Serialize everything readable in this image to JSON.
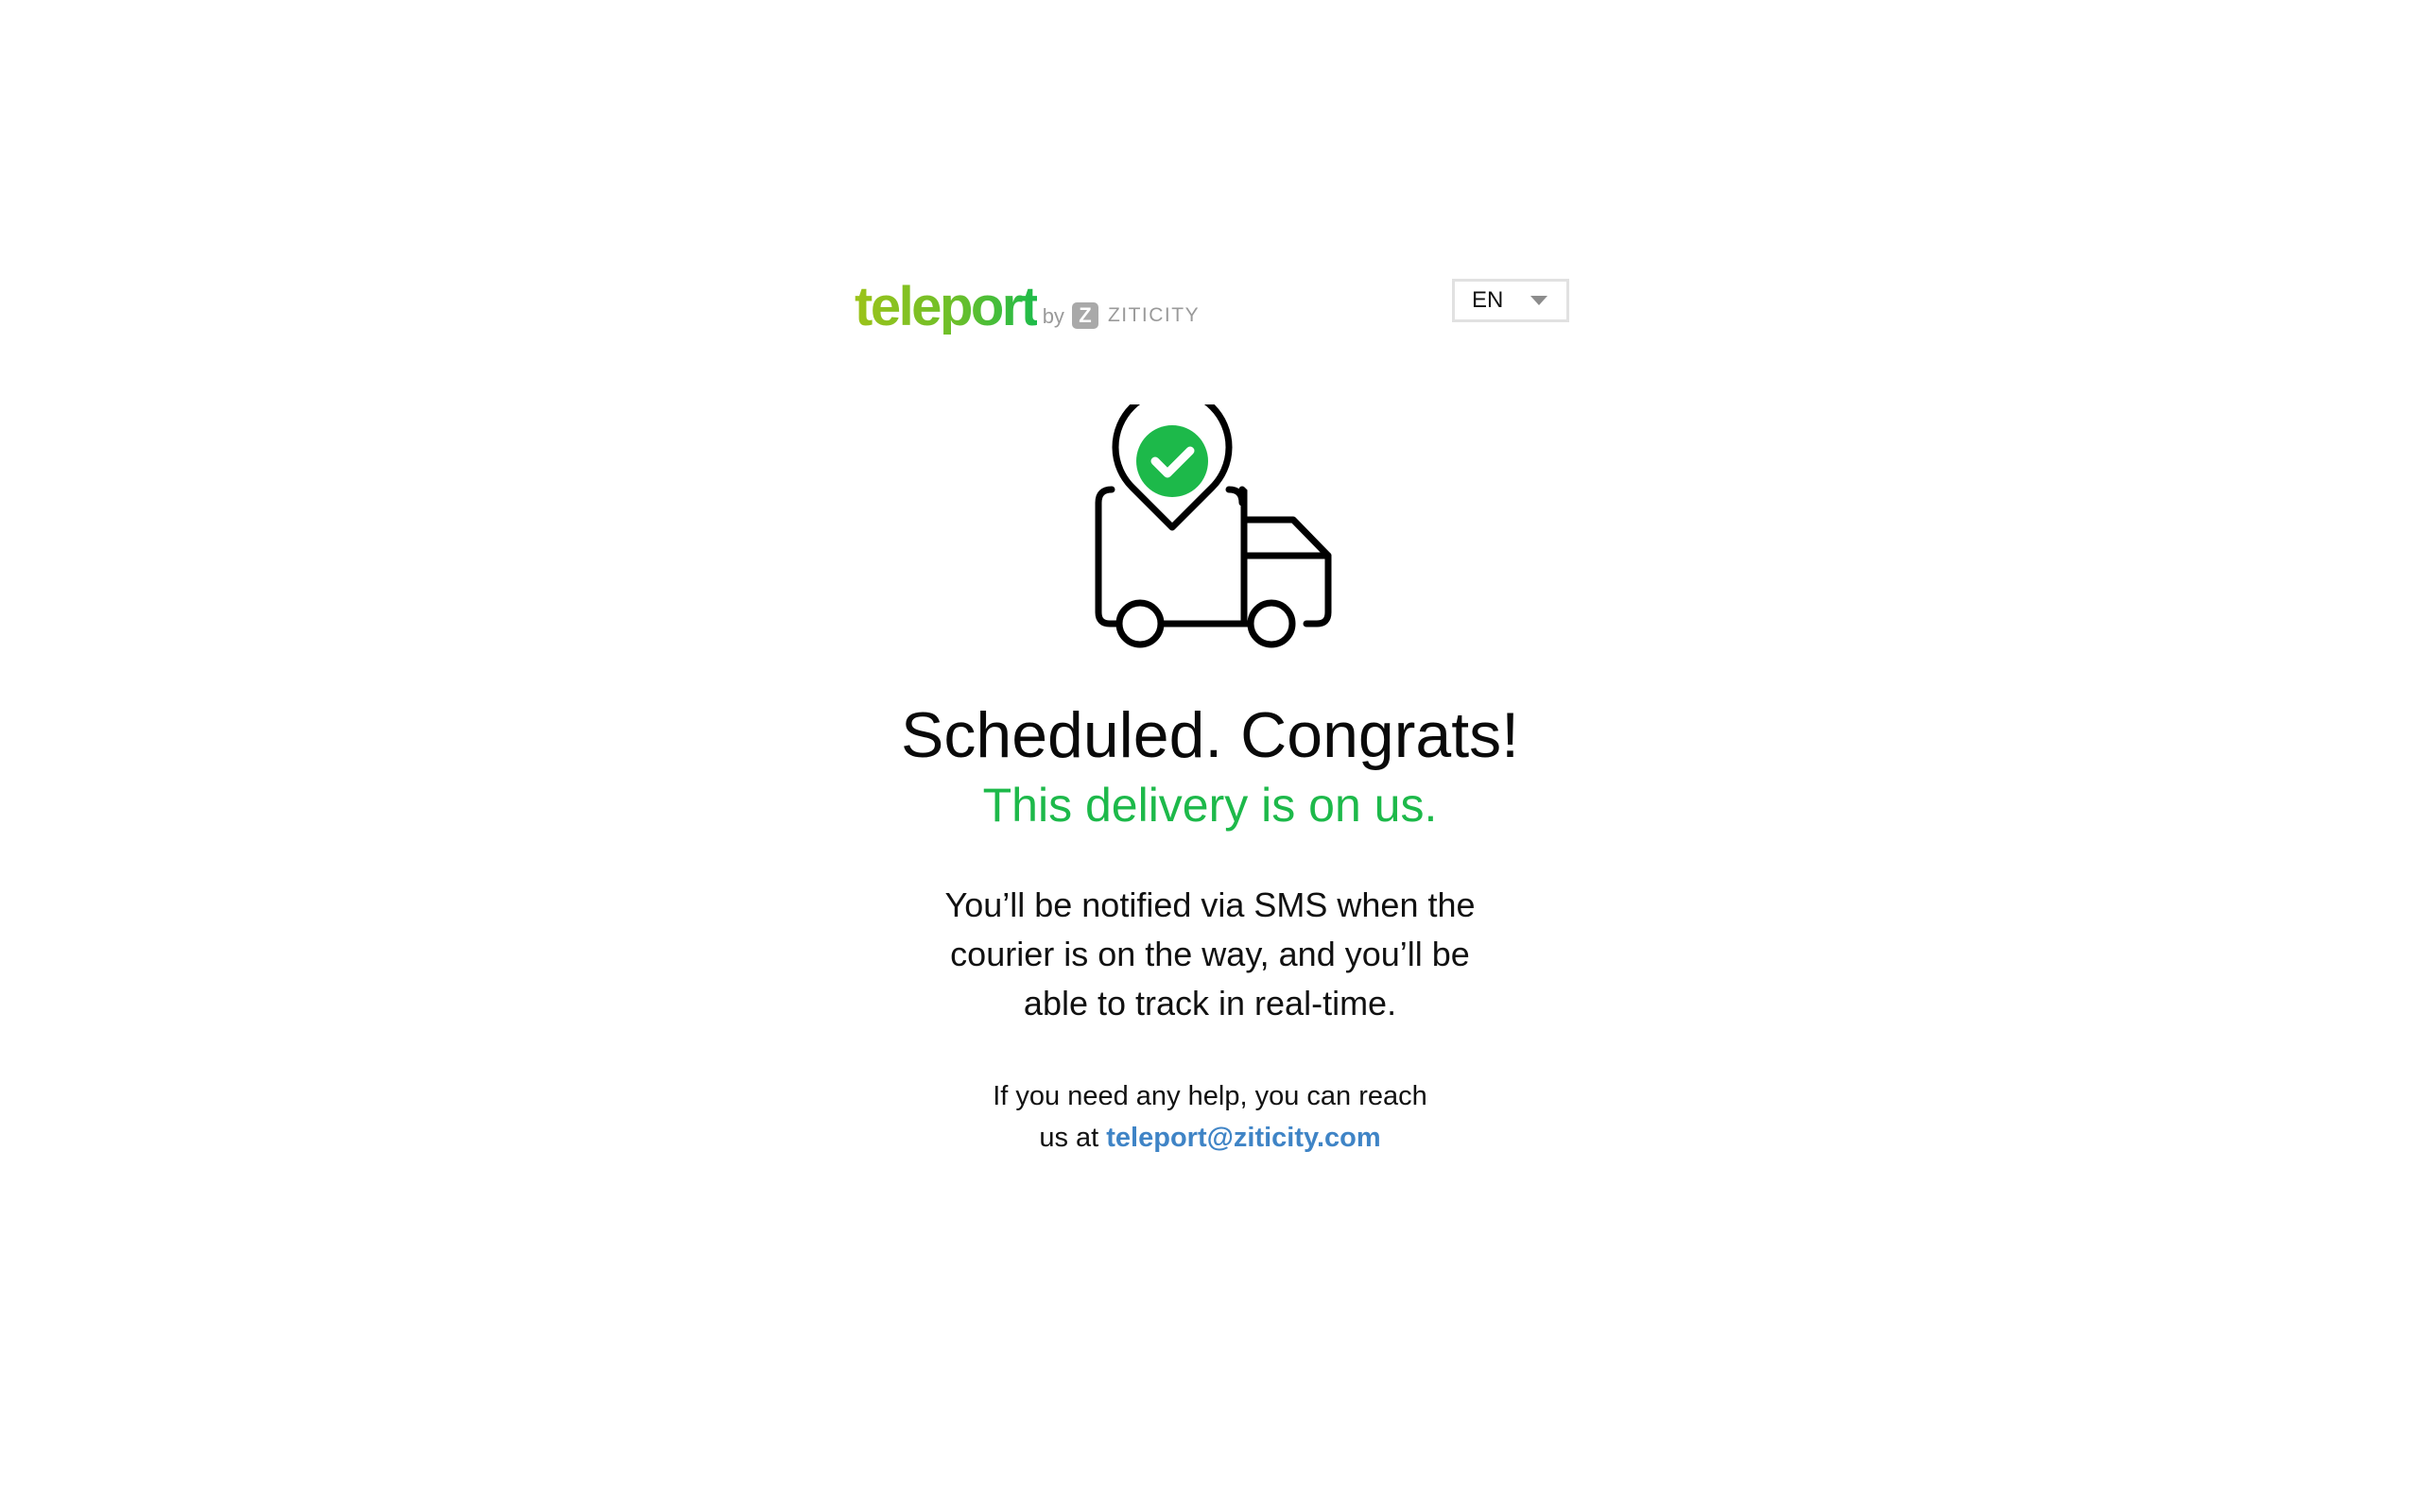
{
  "header": {
    "logo": {
      "wordmark": "teleport",
      "by": "by",
      "z_mark": "Z",
      "company": "ZITICITY"
    },
    "language_select": {
      "value": "EN",
      "icon": "caret-down-icon"
    }
  },
  "hero": {
    "icon": "delivery-truck-location-check-icon",
    "colors": {
      "accent_green": "#1db94a",
      "link_blue": "#3f84c6"
    }
  },
  "confirmation": {
    "title": "Scheduled. Congrats!",
    "subtitle": "This delivery is on us.",
    "body": "You’ll be notified via SMS when the courier is on the way, and you’ll be able to track in real-time.",
    "help_prefix": "If you need any help, you can reach us at ",
    "help_email": "teleport@ziticity.com"
  }
}
